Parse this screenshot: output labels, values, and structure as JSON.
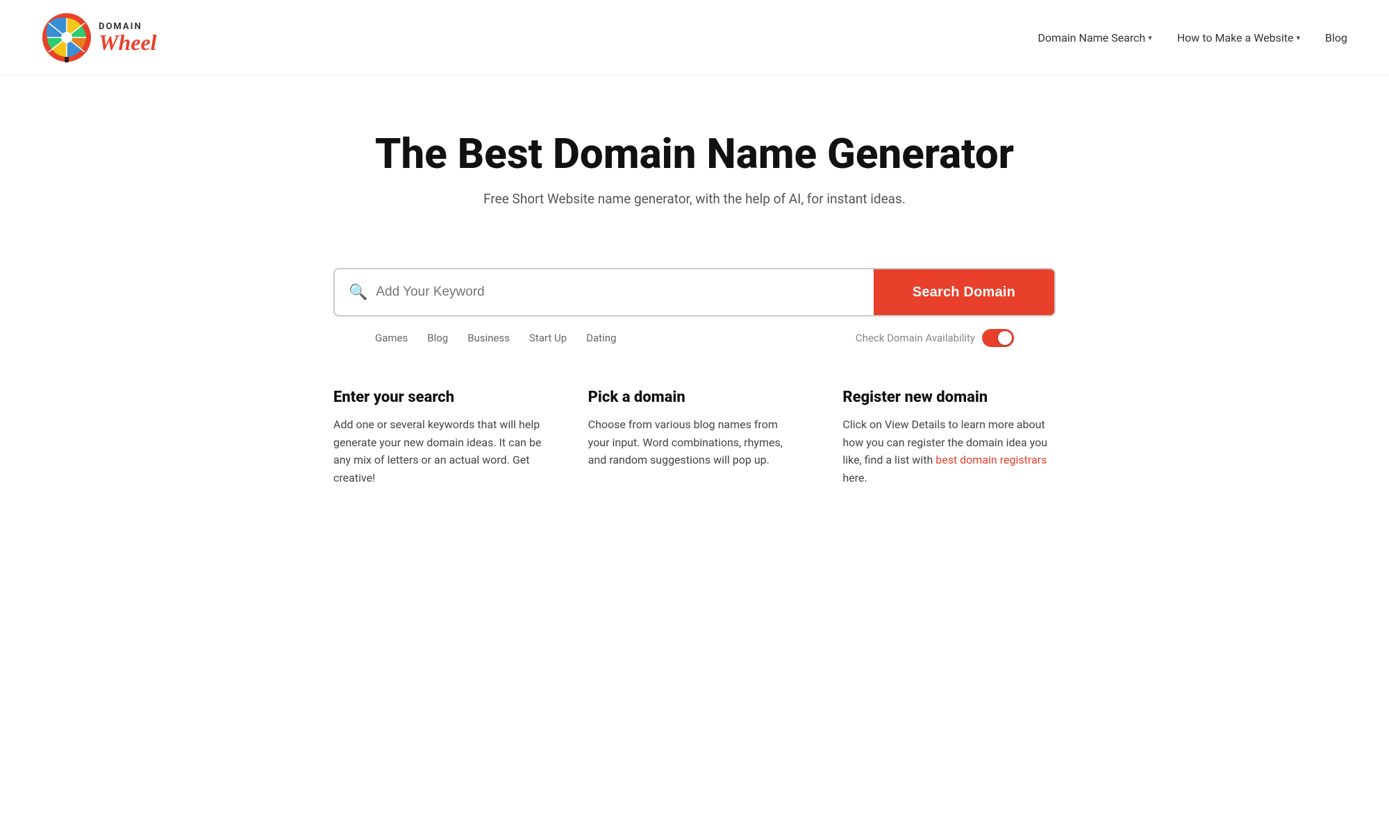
{
  "header": {
    "logo_domain": "DOMAIN",
    "logo_wheel": "Wheel",
    "nav_items": [
      {
        "label": "Domain Name Search",
        "has_dropdown": true
      },
      {
        "label": "How to Make a Website",
        "has_dropdown": true
      },
      {
        "label": "Blog",
        "has_dropdown": false
      }
    ]
  },
  "hero": {
    "title": "The Best Domain Name Generator",
    "subtitle": "Free Short Website name generator, with the help of AI, for instant ideas."
  },
  "search": {
    "placeholder": "Add Your Keyword",
    "button_label": "Search Domain",
    "keyword_tags": [
      "Games",
      "Blog",
      "Business",
      "Start Up",
      "Dating"
    ],
    "domain_availability_label": "Check Domain Availability",
    "toggle_active": true
  },
  "features": [
    {
      "title": "Enter your search",
      "description": "Add one or several keywords that will help generate your new domain ideas. It can be any mix of letters or an actual word. Get creative!"
    },
    {
      "title": "Pick a domain",
      "description": "Choose from various blog names from your input. Word combinations, rhymes, and random suggestions will pop up."
    },
    {
      "title": "Register new domain",
      "description_parts": [
        "Click on View Details to learn more about how you can register the domain idea you like, find a list with ",
        "best domain registrars",
        " here."
      ]
    }
  ]
}
